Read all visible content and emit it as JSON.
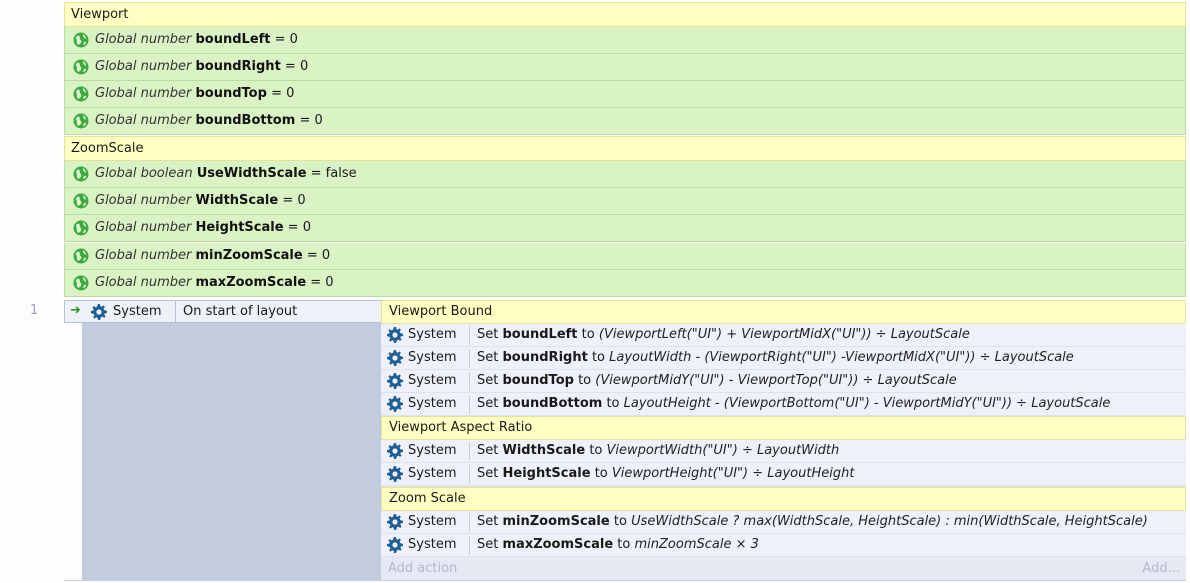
{
  "groups": [
    {
      "title": "Viewport"
    },
    {
      "title": "ZoomScale"
    }
  ],
  "globals": [
    {
      "kw": "Global number",
      "name": "boundLeft",
      "value": "= 0"
    },
    {
      "kw": "Global number",
      "name": "boundRight",
      "value": "= 0"
    },
    {
      "kw": "Global number",
      "name": "boundTop",
      "value": "= 0"
    },
    {
      "kw": "Global number",
      "name": "boundBottom",
      "value": "= 0"
    },
    {
      "kw": "Global boolean",
      "name": "UseWidthScale",
      "value": "= false"
    },
    {
      "kw": "Global number",
      "name": "WidthScale",
      "value": "= 0"
    },
    {
      "kw": "Global number",
      "name": "HeightScale",
      "value": "= 0"
    },
    {
      "kw": "Global number",
      "name": "minZoomScale",
      "value": "= 0"
    },
    {
      "kw": "Global number",
      "name": "maxZoomScale",
      "value": "= 0"
    }
  ],
  "event": {
    "line_number": "1",
    "object": "System",
    "condition": "On start of layout"
  },
  "subgroups": [
    {
      "title": "Viewport Bound"
    },
    {
      "title": "Viewport Aspect Ratio"
    },
    {
      "title": "Zoom Scale"
    }
  ],
  "actions": [
    {
      "object": "System",
      "set": "Set",
      "var": "boundLeft",
      "to": "to",
      "expr": "(ViewportLeft(\"UI\") + ViewportMidX(\"UI\")) ÷ LayoutScale"
    },
    {
      "object": "System",
      "set": "Set",
      "var": "boundRight",
      "to": "to",
      "expr": "LayoutWidth - (ViewportRight(\"UI\") -ViewportMidX(\"UI\")) ÷ LayoutScale"
    },
    {
      "object": "System",
      "set": "Set",
      "var": "boundTop",
      "to": "to",
      "expr": "(ViewportMidY(\"UI\") - ViewportTop(\"UI\")) ÷ LayoutScale"
    },
    {
      "object": "System",
      "set": "Set",
      "var": "boundBottom",
      "to": "to",
      "expr": "LayoutHeight - (ViewportBottom(\"UI\") - ViewportMidY(\"UI\")) ÷ LayoutScale"
    },
    {
      "object": "System",
      "set": "Set",
      "var": "WidthScale",
      "to": "to",
      "expr": "ViewportWidth(\"UI\") ÷ LayoutWidth"
    },
    {
      "object": "System",
      "set": "Set",
      "var": "HeightScale",
      "to": "to",
      "expr": "ViewportHeight(\"UI\") ÷ LayoutHeight"
    },
    {
      "object": "System",
      "set": "Set",
      "var": "minZoomScale",
      "to": "to",
      "expr": "UseWidthScale ? max(WidthScale, HeightScale) : min(WidthScale, HeightScale)"
    },
    {
      "object": "System",
      "set": "Set",
      "var": "maxZoomScale",
      "to": "to",
      "expr": "minZoomScale × 3"
    }
  ],
  "footer": {
    "add_action": "Add action",
    "add_more": "Add..."
  },
  "colors": {
    "group_header": "#ffffc4",
    "global_row": "#daf3c5",
    "event_block": "#c3ccdf",
    "globe_icon": "#3fa83f",
    "gear_icon": "#1f5f96"
  }
}
